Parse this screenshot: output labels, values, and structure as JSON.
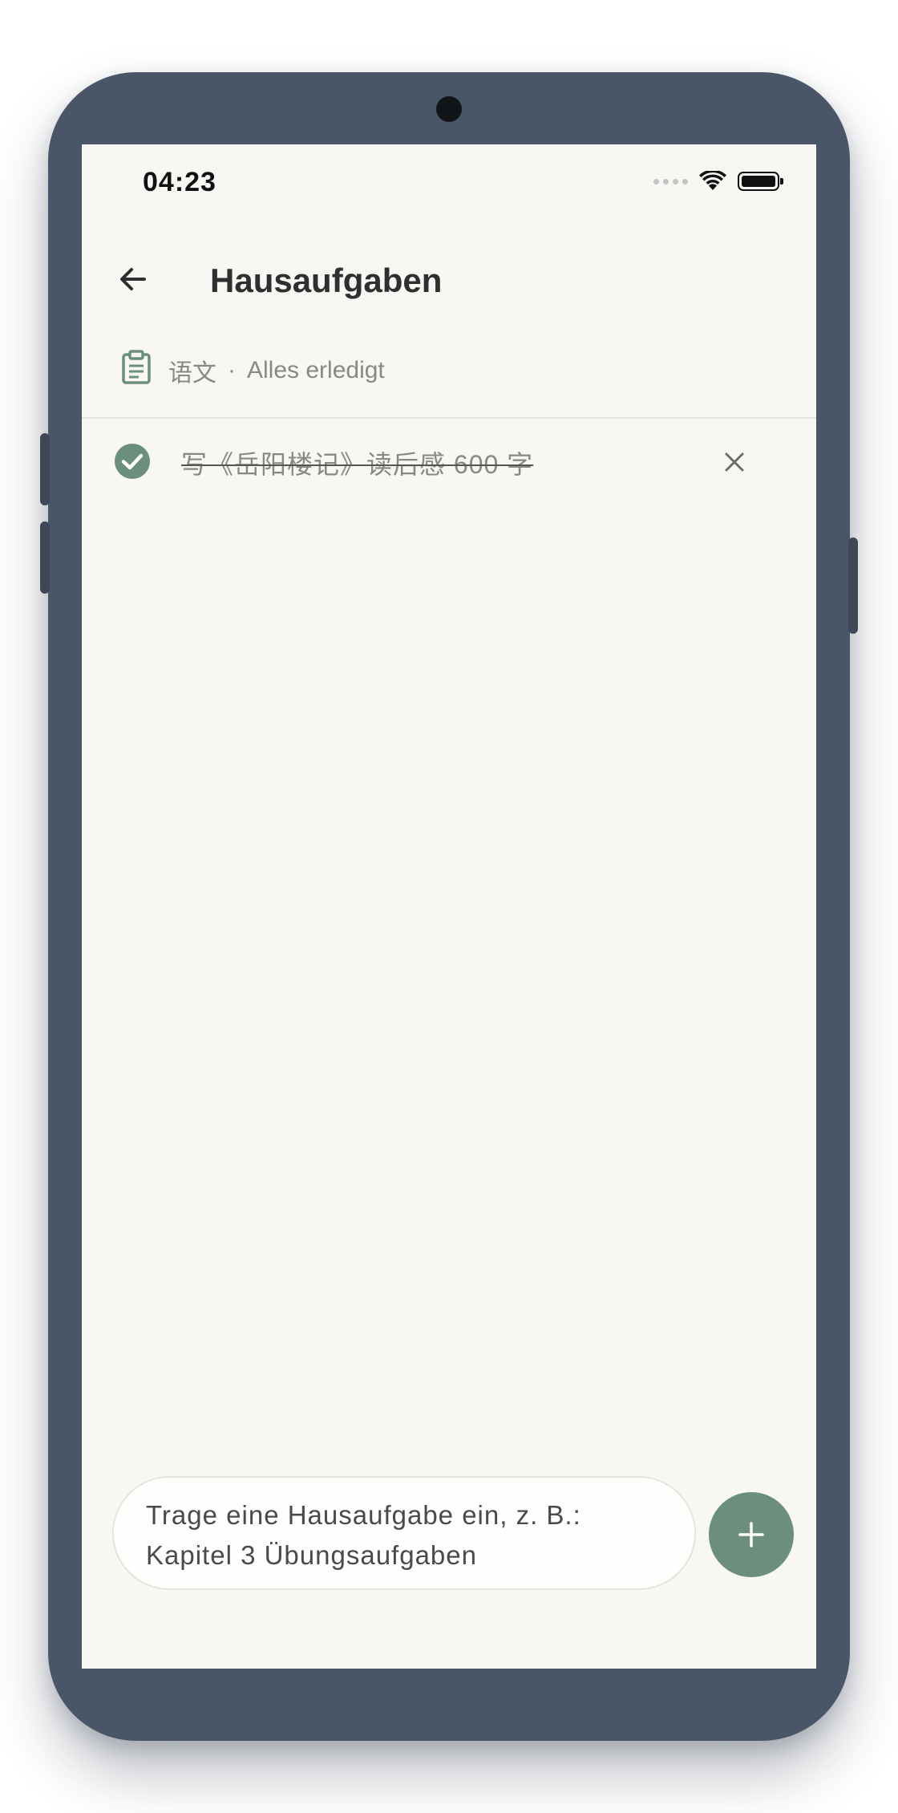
{
  "status_bar": {
    "time": "04:23"
  },
  "header": {
    "title": "Hausaufgaben"
  },
  "subject": {
    "name": "语文",
    "separator": "·",
    "status": "Alles erledigt"
  },
  "tasks": [
    {
      "text": "写《岳阳楼记》读后感 600 字",
      "done": true
    }
  ],
  "input": {
    "placeholder": "Trage eine Hausaufgabe ein, z. B.: Kapitel 3 Übungsaufgaben"
  },
  "icons": {
    "back": "arrow-left-icon",
    "subject": "clipboard-icon",
    "task_done": "check-circle-icon",
    "delete": "close-icon",
    "add": "plus-icon",
    "wifi": "wifi-icon",
    "battery": "battery-icon",
    "signal": "signal-dots-icon"
  },
  "colors": {
    "accent": "#6b8f7c",
    "background": "#f8f7f3",
    "frame": "#4a5568",
    "muted_text": "#8a8883"
  }
}
